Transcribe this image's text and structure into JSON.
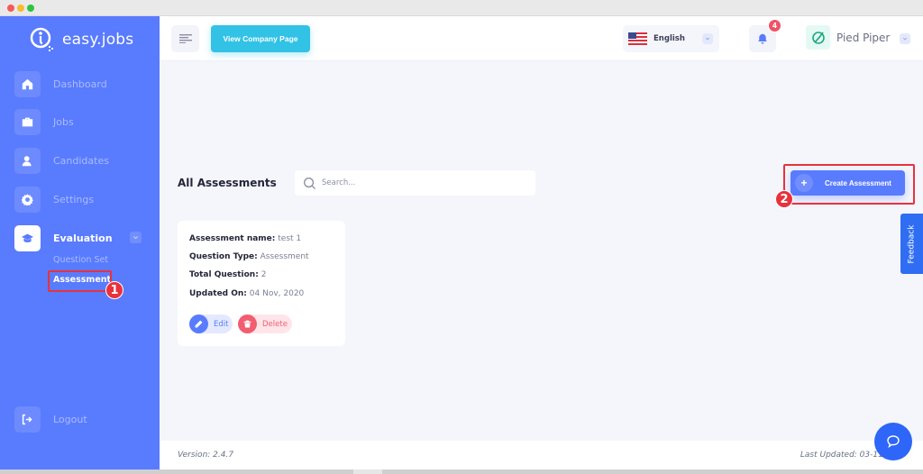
{
  "app": {
    "brand": "easy.jobs"
  },
  "sidebar": {
    "items": [
      {
        "label": "Dashboard",
        "icon": "home-icon"
      },
      {
        "label": "Jobs",
        "icon": "briefcase-icon"
      },
      {
        "label": "Candidates",
        "icon": "user-icon"
      },
      {
        "label": "Settings",
        "icon": "gear-icon"
      },
      {
        "label": "Evaluation",
        "icon": "graduation-cap-icon",
        "active": true
      }
    ],
    "sub_items": [
      {
        "label": "Question Set"
      },
      {
        "label": "Assessment",
        "active": true
      }
    ],
    "logout_label": "Logout"
  },
  "header": {
    "view_company_label": "View Company Page",
    "language": "English",
    "notification_count": "4",
    "company_name": "Pied Piper"
  },
  "main": {
    "title": "All Assessments",
    "search_placeholder": "Search...",
    "create_label": "Create Assessment",
    "cards": [
      {
        "name_label": "Assessment name:",
        "name_value": "test 1",
        "type_label": "Question Type:",
        "type_value": "Assessment",
        "total_label": "Total Question:",
        "total_value": "2",
        "updated_label": "Updated On:",
        "updated_value": "04 Nov, 2020",
        "edit_label": "Edit",
        "delete_label": "Delete"
      }
    ]
  },
  "annotations": {
    "step1": "1",
    "step2": "2",
    "color": "#e8323c"
  },
  "feedback_label": "Feedback",
  "footer": {
    "version": "Version: 2.4.7",
    "last_updated": "Last Updated: 03-11-2020"
  },
  "colors": {
    "primary": "#597bfe",
    "accent_cyan": "#31c2e6",
    "danger": "#f25d70",
    "feedback": "#2f6ef2"
  }
}
